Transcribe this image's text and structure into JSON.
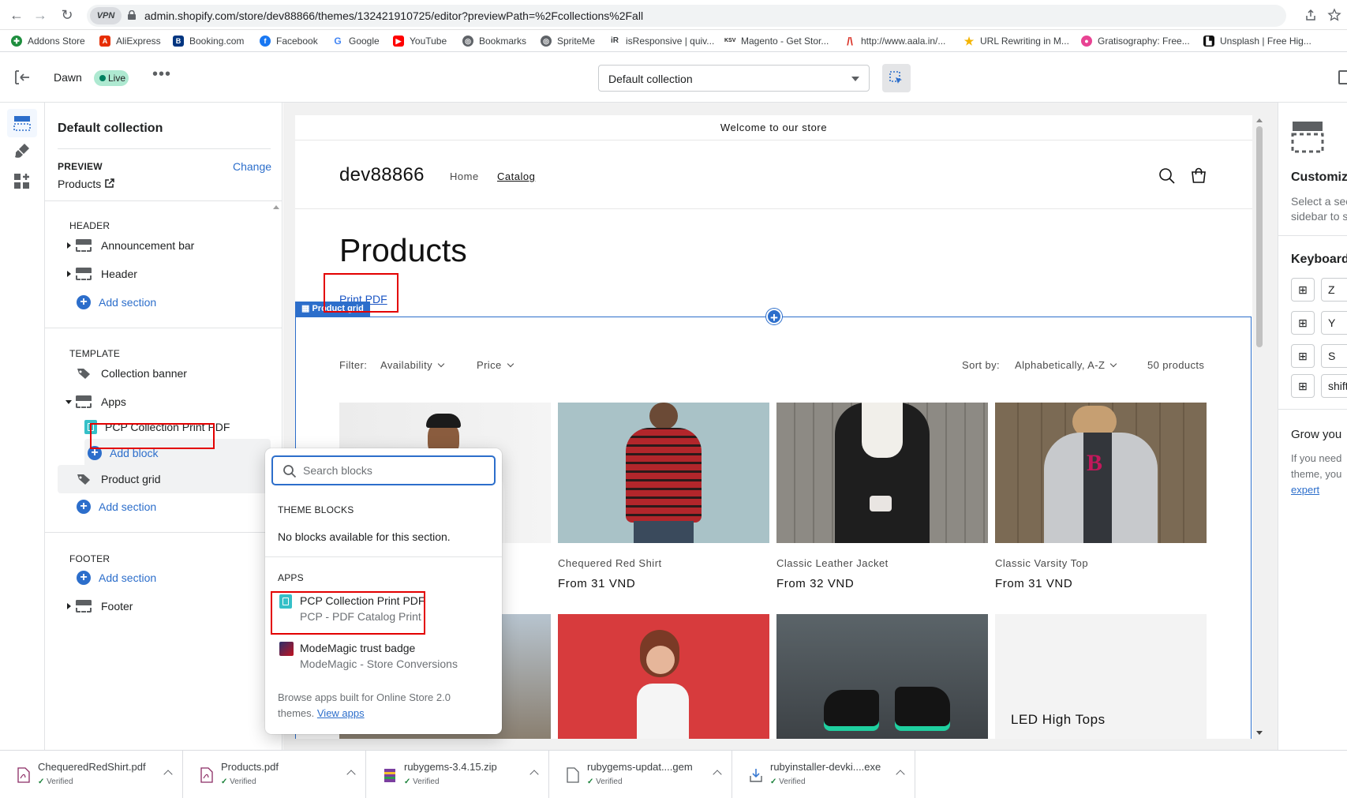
{
  "browser": {
    "url": "admin.shopify.com/store/dev88866/themes/132421910725/editor?previewPath=%2Fcollections%2Fall",
    "vpn_label": "VPN"
  },
  "bookmarks": [
    {
      "label": "Addons Store",
      "icon": "addons-icon",
      "color": "#1e8e3e"
    },
    {
      "label": "AliExpress",
      "icon": "aliexpress-icon",
      "color": "#e62e04"
    },
    {
      "label": "Booking.com",
      "icon": "booking-icon",
      "color": "#003580"
    },
    {
      "label": "Facebook",
      "icon": "facebook-icon",
      "color": "#1877f2"
    },
    {
      "label": "Google",
      "icon": "google-icon",
      "color": "#4285f4"
    },
    {
      "label": "YouTube",
      "icon": "youtube-icon",
      "color": "#ff0000"
    },
    {
      "label": "Bookmarks",
      "icon": "globe-icon",
      "color": "#5f6368"
    },
    {
      "label": "SpriteMe",
      "icon": "globe-icon",
      "color": "#5f6368"
    },
    {
      "label": "isResponsive | quiv...",
      "icon": "isresponsive-icon",
      "color": "#3c4043"
    },
    {
      "label": "Magento - Get Stor...",
      "icon": "magento-icon",
      "color": "#222222"
    },
    {
      "label": "http://www.aala.in/...",
      "icon": "aala-icon",
      "color": "#d93025"
    },
    {
      "label": "URL Rewriting in M...",
      "icon": "star-icon",
      "color": "#f4b400"
    },
    {
      "label": "Gratisography: Free...",
      "icon": "gratisography-icon",
      "color": "#e84393"
    },
    {
      "label": "Unsplash | Free Hig...",
      "icon": "unsplash-icon",
      "color": "#111111"
    }
  ],
  "topbar": {
    "theme_name": "Dawn",
    "live_badge": "Live",
    "template_select": "Default collection"
  },
  "sidebar": {
    "title": "Default collection",
    "preview_label": "PREVIEW",
    "preview_value": "Products",
    "change_link": "Change",
    "header_group": "HEADER",
    "announcement_bar": "Announcement bar",
    "header": "Header",
    "add_section": "Add section",
    "template_group": "TEMPLATE",
    "collection_banner": "Collection banner",
    "apps": "Apps",
    "pcp_block": "PCP Collection Print PDF",
    "add_block": "Add block",
    "product_grid": "Product grid",
    "footer_group": "FOOTER",
    "footer": "Footer"
  },
  "preview": {
    "announcement": "Welcome to our store",
    "store_name": "dev88866",
    "nav_home": "Home",
    "nav_catalog": "Catalog",
    "page_title": "Products",
    "print_pdf": "Print PDF",
    "section_tag": "Product grid",
    "filter_label": "Filter:",
    "filter_availability": "Availability",
    "filter_price": "Price",
    "sort_label": "Sort by:",
    "sort_value": "Alphabetically, A-Z",
    "product_count": "50 products",
    "products": [
      {
        "name": "",
        "price": ""
      },
      {
        "name": "Chequered Red Shirt",
        "price": "From 31 VND"
      },
      {
        "name": "Classic Leather Jacket",
        "price": "From 32 VND"
      },
      {
        "name": "Classic Varsity Top",
        "price": "From 31 VND"
      }
    ],
    "row2_last_name": "LED High Tops"
  },
  "popover": {
    "search_placeholder": "Search blocks",
    "theme_blocks_heading": "THEME BLOCKS",
    "no_blocks": "No blocks available for this section.",
    "apps_heading": "APPS",
    "app1_title": "PCP Collection Print PDF",
    "app1_sub": "PCP - PDF Catalog Print",
    "app2_title": "ModeMagic trust badge",
    "app2_sub": "ModeMagic - Store Conversions",
    "browse_text": "Browse apps built for Online Store 2.0 themes.",
    "view_apps": "View apps"
  },
  "right_panel": {
    "customize_title": "Customize",
    "customize_text_1": "Select a sec",
    "customize_text_2": "sidebar to s",
    "keyboard_title": "Keyboard",
    "keys": [
      "Z",
      "Y",
      "S",
      "shift"
    ],
    "grow_title": "Grow you",
    "grow_text_1": "If you need",
    "grow_text_2": "theme, you",
    "grow_link": "expert"
  },
  "downloads": [
    {
      "name": "ChequeredRedShirt.pdf",
      "status": "Verified"
    },
    {
      "name": "Products.pdf",
      "status": "Verified"
    },
    {
      "name": "rubygems-3.4.15.zip",
      "status": "Verified"
    },
    {
      "name": "rubygems-updat....gem",
      "status": "Verified"
    },
    {
      "name": "rubyinstaller-devki....exe",
      "status": "Verified"
    }
  ],
  "colors": {
    "accent": "#2c6ecb",
    "highlight": "#e30000",
    "live_badge": "#aee9d1"
  }
}
